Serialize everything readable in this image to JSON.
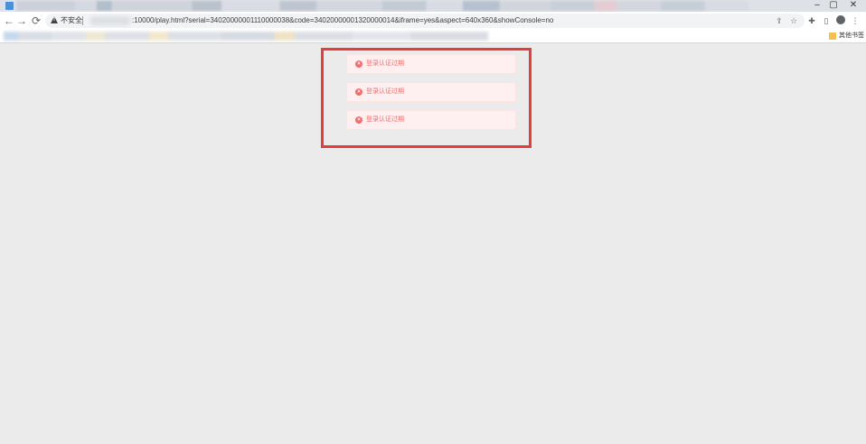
{
  "browser": {
    "controls": {
      "minimize": "–",
      "restore": "▢",
      "close": "✕"
    },
    "omnibox": {
      "security_label": "不安全",
      "url_visible": ":10000/play.html?serial=34020000001110000038&code=34020000001320000014&iframe=yes&aspect=640x360&showConsole=no"
    },
    "bookmarks": {
      "other_label": "其他书签"
    },
    "icons": [
      "back-icon",
      "forward-icon",
      "reload-icon",
      "share-icon",
      "star-icon",
      "extensions-icon",
      "side-panel-icon",
      "profile-icon",
      "menu-icon"
    ]
  },
  "page": {
    "highlight_color": "#e63c3c",
    "messages": [
      {
        "type": "error",
        "text": "登录认证过期"
      },
      {
        "type": "error",
        "text": "登录认证过期"
      },
      {
        "type": "error",
        "text": "登录认证过期"
      }
    ],
    "error_color": "#f56c6c",
    "error_bg": "#fef0f0"
  }
}
